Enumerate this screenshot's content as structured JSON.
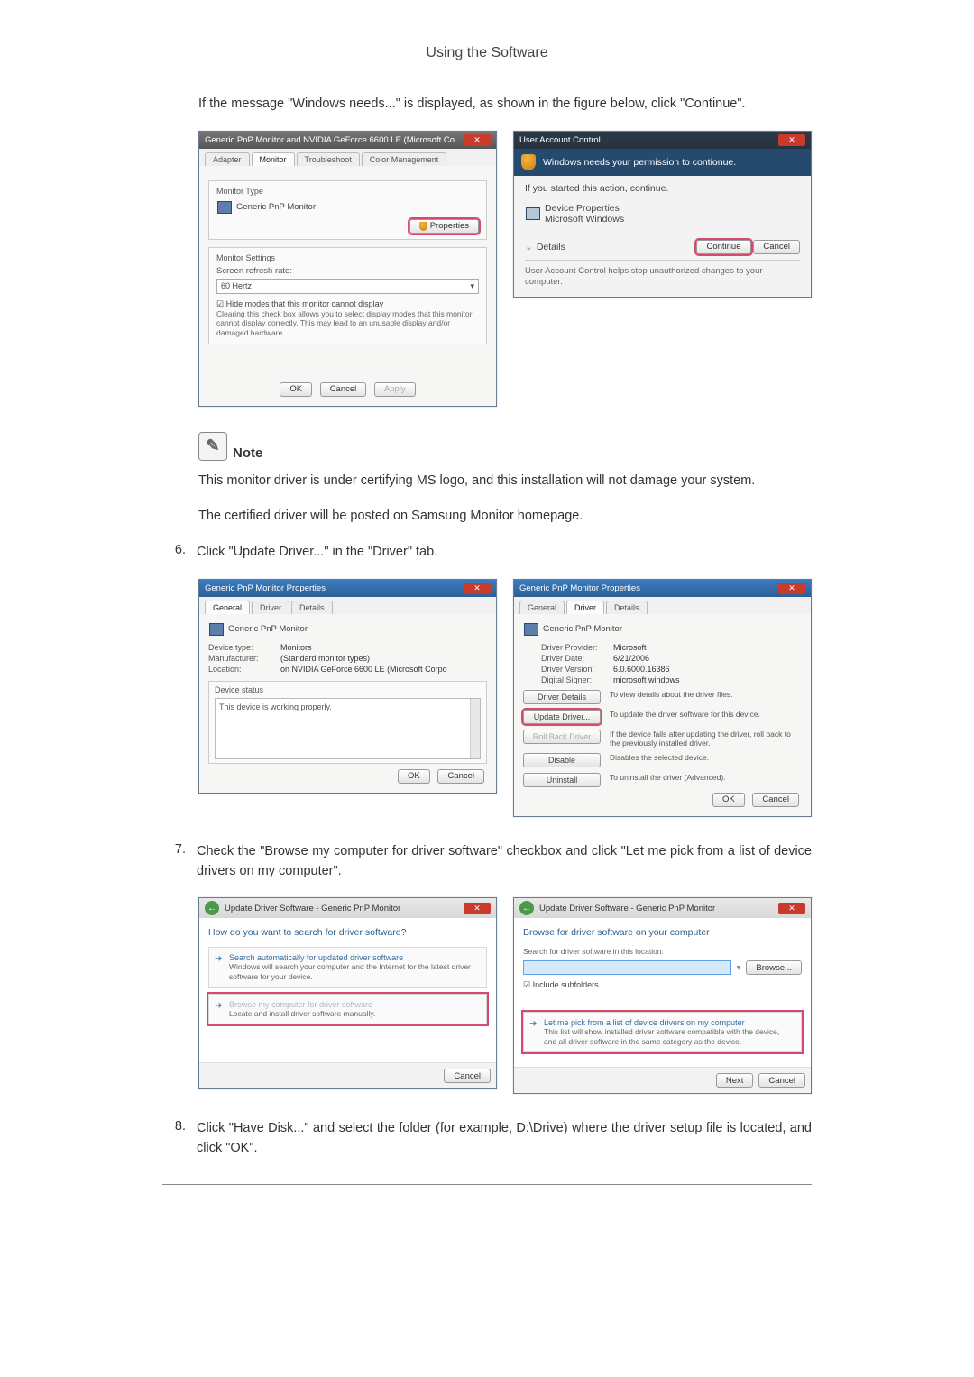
{
  "header": {
    "title": "Using the Software"
  },
  "intro": "If the message \"Windows needs...\" is displayed, as shown in the figure below, click \"Continue\".",
  "fig1_left": {
    "title": "Generic PnP Monitor and NVIDIA GeForce 6600 LE (Microsoft Co...",
    "tabs": {
      "adapter": "Adapter",
      "monitor": "Monitor",
      "troubleshoot": "Troubleshoot",
      "color": "Color Management"
    },
    "monitor_type_label": "Monitor Type",
    "monitor_name": "Generic PnP Monitor",
    "properties_btn": "Properties",
    "settings_label": "Monitor Settings",
    "refresh_label": "Screen refresh rate:",
    "refresh_value": "60 Hertz",
    "hide_modes_check": "Hide modes that this monitor cannot display",
    "hide_modes_note": "Clearing this check box allows you to select display modes that this monitor cannot display correctly. This may lead to an unusable display and/or damaged hardware.",
    "buttons": {
      "ok": "OK",
      "cancel": "Cancel",
      "apply": "Apply"
    }
  },
  "fig1_right": {
    "title": "User Account Control",
    "banner": "Windows needs your permission to contionue.",
    "if_started": "If you started this action, continue.",
    "prog_name": "Device Properties",
    "publisher": "Microsoft Windows",
    "details_btn": "Details",
    "continue_btn": "Continue",
    "cancel_btn": "Cancel",
    "footer": "User Account Control helps stop unauthorized changes to your computer."
  },
  "note": {
    "label": "Note",
    "line1": "This monitor driver is under certifying MS logo, and this installation will not damage your system.",
    "line2": "The certified driver will be posted on Samsung Monitor homepage."
  },
  "step6": {
    "num": "6.",
    "text": "Click \"Update Driver...\" in the \"Driver\" tab."
  },
  "fig2_left": {
    "title": "Generic PnP Monitor Properties",
    "tabs": {
      "general": "General",
      "driver": "Driver",
      "details": "Details"
    },
    "device_name": "Generic PnP Monitor",
    "kv": {
      "type_k": "Device type:",
      "type_v": "Monitors",
      "manu_k": "Manufacturer:",
      "manu_v": "(Standard monitor types)",
      "loc_k": "Location:",
      "loc_v": "on NVIDIA GeForce 6600 LE (Microsoft Corpo"
    },
    "status_label": "Device status",
    "status_text": "This device is working properly.",
    "ok": "OK",
    "cancel": "Cancel"
  },
  "fig2_right": {
    "title": "Generic PnP Monitor Properties",
    "tabs": {
      "general": "General",
      "driver": "Driver",
      "details": "Details"
    },
    "device_name": "Generic PnP Monitor",
    "kv": {
      "prov_k": "Driver Provider:",
      "prov_v": "Microsoft",
      "date_k": "Driver Date:",
      "date_v": "6/21/2006",
      "ver_k": "Driver Version:",
      "ver_v": "6.0.6000.16386",
      "sign_k": "Digital Signer:",
      "sign_v": "microsoft windows"
    },
    "btns": {
      "details": "Driver Details",
      "details_d": "To view details about the driver files.",
      "update": "Update Driver...",
      "update_d": "To update the driver software for this device.",
      "rollback": "Roll Back Driver",
      "rollback_d": "If the device fails after updating the driver, roll back to the previously installed driver.",
      "disable": "Disable",
      "disable_d": "Disables the selected device.",
      "uninstall": "Uninstall",
      "uninstall_d": "To uninstall the driver (Advanced)."
    },
    "ok": "OK",
    "cancel": "Cancel"
  },
  "step7": {
    "num": "7.",
    "text": "Check the \"Browse my computer for driver software\" checkbox and click \"Let me pick from a list of device drivers on my computer\"."
  },
  "fig3_left": {
    "title": "Update Driver Software - Generic PnP Monitor",
    "heading": "How do you want to search for driver software?",
    "opt1_title": "Search automatically for updated driver software",
    "opt1_sub": "Windows will search your computer and the Internet for the latest driver software for your device.",
    "opt2_title": "Browse my computer for driver software",
    "opt2_sub": "Locate and install driver software manually.",
    "cancel": "Cancel"
  },
  "fig3_right": {
    "title": "Update Driver Software - Generic PnP Monitor",
    "heading": "Browse for driver software on your computer",
    "search_label": "Search for driver software in this location:",
    "browse_btn": "Browse...",
    "include_sub": "Include subfolders",
    "opt_title": "Let me pick from a list of device drivers on my computer",
    "opt_sub": "This list will show installed driver software compatible with the device, and all driver software in the same category as the device.",
    "next": "Next",
    "cancel": "Cancel"
  },
  "step8": {
    "num": "8.",
    "text": "Click \"Have Disk...\" and select the folder (for example, D:\\Drive) where the driver setup file is located, and click \"OK\"."
  }
}
